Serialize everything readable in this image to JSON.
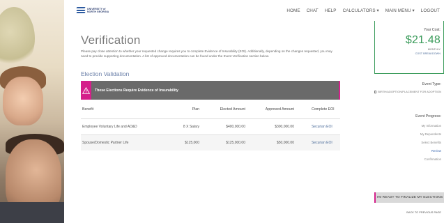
{
  "header": {
    "logo_line1": "UNIVERSITY of",
    "logo_line2": "NORTH GEORGIA",
    "nav": [
      "HOME",
      "CHAT",
      "HELP",
      "CALCULATORS ▾",
      "MAIN MENU ▾",
      "LOGOUT"
    ]
  },
  "main": {
    "title": "Verification",
    "intro": "Please pay close attention to whether your requested change requires you to complete Evidence of Insurability (EOI). Additionally, depending on the changes requested, you may need to provide supporting documentation. A list of approved documentation can be found under the Event Verification section below.",
    "section_title": "Election Validation",
    "alert_text": "These Elections Require Evidence of Insurability",
    "table": {
      "headers": [
        "Benefit",
        "Plan",
        "Elected Amount",
        "Approved Amount",
        "Complete EOI"
      ],
      "rows": [
        [
          "Employee Voluntary Life and AD&D",
          "8 X Salary",
          "$400,000.00",
          "$300,000.00",
          "Securian EOI"
        ],
        [
          "Spouse/Domestic Partner Life",
          "$125,000",
          "$125,000.00",
          "$50,000.00",
          "Securian EOI"
        ]
      ]
    }
  },
  "sidebar": {
    "cost_label": "Your Cost:",
    "cost_value": "$21.48",
    "cost_period": "MONTHLY",
    "cost_link": "COST BREAKDOWN",
    "event_type_label": "Event Type:",
    "event_type_value": "BIRTH/ADOPTION/PLACEMENT FOR ADOPTION",
    "progress_label": "Event Progress:",
    "steps": [
      "My Information",
      "My Dependents",
      "Select Benefits",
      "Review",
      "Confirmation"
    ],
    "active_step": "Review",
    "finalize_button": "I'M READY TO FINALIZE MY ELECTIONS",
    "back_link": "BACK TO PREVIOUS PAGE"
  },
  "colors": {
    "accent_pink": "#d4208a",
    "accent_green": "#3a9b5a",
    "link_blue": "#4d6d9a",
    "alert_gray": "#6a6a6a"
  }
}
